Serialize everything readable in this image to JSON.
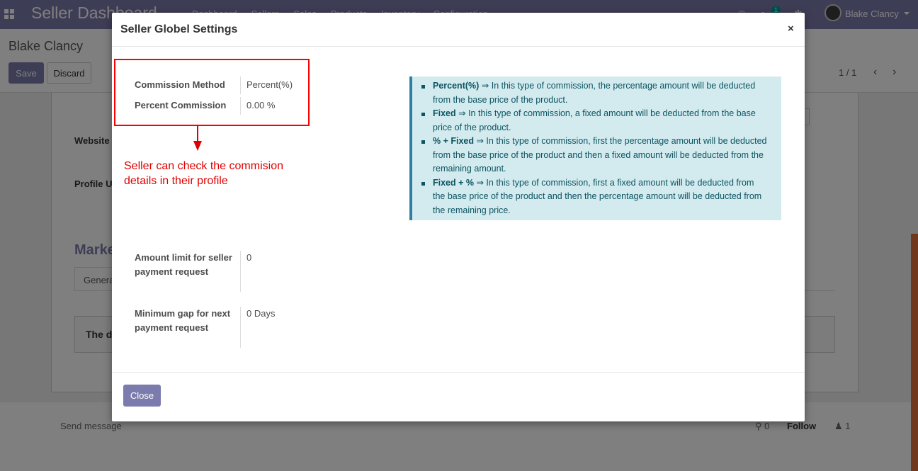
{
  "navbar": {
    "app_title": "Seller Dashboard",
    "menu": [
      "Dashboard",
      "Sellers",
      "Sales",
      "Products",
      "Inventory",
      "Configuration"
    ],
    "messages_badge": "1",
    "user_name": "Blake Clancy",
    "color": "#7c7bad"
  },
  "control_panel": {
    "breadcrumb": "Blake Clancy",
    "save_label": "Save",
    "discard_label": "Discard",
    "pager": "1 / 1"
  },
  "background_form": {
    "website_label": "Website",
    "profile_label": "Profile U",
    "heading": "Marke",
    "tab": "Genera",
    "box_text": "The d"
  },
  "chatter": {
    "send_message": "Send message",
    "attachments": "0",
    "follow": "Follow",
    "followers": "1"
  },
  "modal": {
    "title": "Seller Globel Settings",
    "close_x": "×",
    "fields": {
      "commission_method_label": "Commission Method",
      "commission_method_value": "Percent(%)",
      "percent_commission_label": "Percent Commission",
      "percent_commission_value": "0.00 %",
      "amount_limit_label": "Amount limit for seller payment request",
      "amount_limit_value": "0",
      "minimum_gap_label": "Minimum gap for next payment request",
      "minimum_gap_value": "0 Days"
    },
    "annotation": "Seller can check the commision details in their profile",
    "info": [
      {
        "term": "Percent(%)",
        "text": " ⇒ In this type of commission, the percentage amount will be deducted from the base price of the product."
      },
      {
        "term": "Fixed",
        "text": " ⇒ In this type of commission, a fixed amount will be deducted from the base price of the product."
      },
      {
        "term": "% + Fixed",
        "text": " ⇒ In this type of commission, first the percentage amount will be deducted from the base price of the product and then a fixed amount will be deducted from the remaining amount."
      },
      {
        "term": "Fixed + %",
        "text": " ⇒ In this type of commission, first a fixed amount will be deducted from the base price of the product and then the percentage amount will be deducted from the remaining price."
      }
    ],
    "close_button": "Close",
    "annotation_color": "#e00000"
  }
}
